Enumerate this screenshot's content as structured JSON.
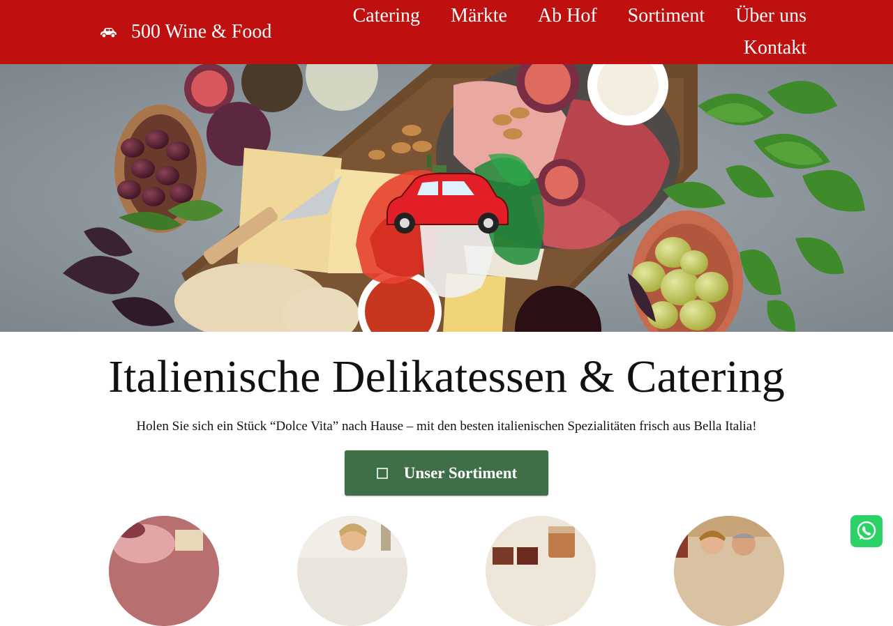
{
  "header": {
    "brand_name": "500 Wine & Food",
    "brand_icon": "car-icon",
    "nav": [
      "Catering",
      "Märkte",
      "Ab Hof",
      "Sortiment",
      "Über uns",
      "Kontakt"
    ]
  },
  "hero": {
    "image": "antipasti-platter-with-red-car-logo",
    "logo_icon": "red-fiat-500-logo"
  },
  "main": {
    "title": "Italienische Delikatessen & Catering",
    "subtitle": "Holen Sie sich ein Stück “Dolce Vita” nach Hause – mit den besten italienischen Spezialitäten frisch aus Bella Italia!",
    "cta_label": "Unser Sortiment",
    "cta_icon": "shopping-icon"
  },
  "feature_images": [
    "cured-meats-photo",
    "chef-woman-photo",
    "jars-preserves-photo",
    "couple-outdoors-photo"
  ],
  "whatsapp": {
    "icon": "whatsapp-icon"
  },
  "colors": {
    "header_red": "#bf0f0f",
    "cta_green": "#3f6f47",
    "whatsapp_green": "#2bd366"
  }
}
